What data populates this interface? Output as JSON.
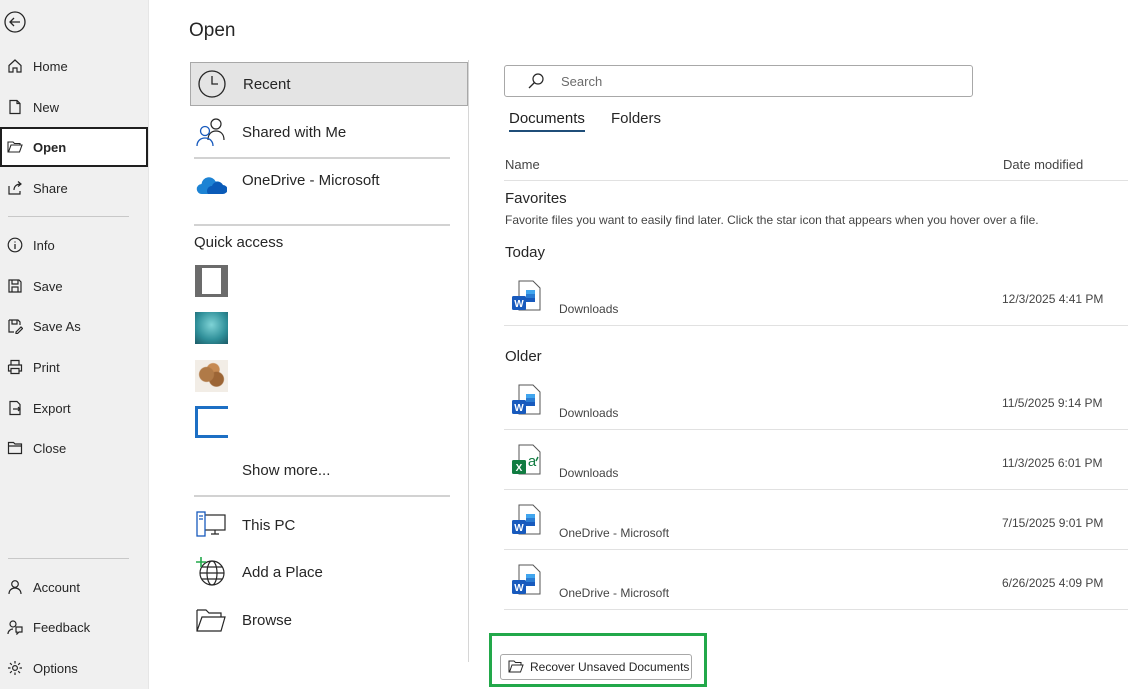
{
  "nav": {
    "back_label": "back-arrow-icon",
    "items": [
      {
        "label": "Home",
        "icon": "home-icon"
      },
      {
        "label": "New",
        "icon": "new-document-icon"
      },
      {
        "label": "Open",
        "icon": "open-folder-icon",
        "active": true
      },
      {
        "label": "Share",
        "icon": "share-icon"
      },
      {
        "label": "Info",
        "icon": "info-icon"
      },
      {
        "label": "Save",
        "icon": "save-icon"
      },
      {
        "label": "Save As",
        "icon": "save-as-icon"
      },
      {
        "label": "Print",
        "icon": "print-icon"
      },
      {
        "label": "Export",
        "icon": "export-icon"
      },
      {
        "label": "Close",
        "icon": "close-folder-icon"
      },
      {
        "label": "Account",
        "icon": "account-icon"
      },
      {
        "label": "Feedback",
        "icon": "feedback-icon"
      },
      {
        "label": "Options",
        "icon": "options-icon"
      }
    ]
  },
  "page_title": "Open",
  "locations": {
    "recent": "Recent",
    "shared": "Shared with Me",
    "onedrive": "OneDrive - Microsoft",
    "quick_access_title": "Quick access",
    "show_more": "Show more...",
    "this_pc": "This PC",
    "add_place": "Add a Place",
    "browse": "Browse"
  },
  "search": {
    "placeholder": "Search"
  },
  "tabs": {
    "documents": "Documents",
    "folders": "Folders"
  },
  "columns": {
    "name": "Name",
    "date": "Date modified"
  },
  "favorites": {
    "title": "Favorites",
    "hint": "Favorite files you want to easily find later. Click the star icon that appears when you hover over a file."
  },
  "groups": {
    "today": "Today",
    "older": "Older"
  },
  "files": [
    {
      "app": "word",
      "location": "Downloads",
      "date": "12/3/2025 4:41 PM"
    },
    {
      "app": "word",
      "location": "Downloads",
      "date": "11/5/2025 9:14 PM"
    },
    {
      "app": "excel",
      "location": "Downloads",
      "date": "11/3/2025 6:01 PM"
    },
    {
      "app": "word",
      "location": "OneDrive - Microsoft",
      "date": "7/15/2025 9:01 PM"
    },
    {
      "app": "word",
      "location": "OneDrive - Microsoft",
      "date": "6/26/2025 4:09 PM"
    }
  ],
  "recover": {
    "label": "Recover Unsaved Documents"
  },
  "colors": {
    "accent_green": "#22a84a",
    "word_blue": "#185abd",
    "excel_green": "#107c41",
    "tab_underline": "#1f4e79"
  }
}
